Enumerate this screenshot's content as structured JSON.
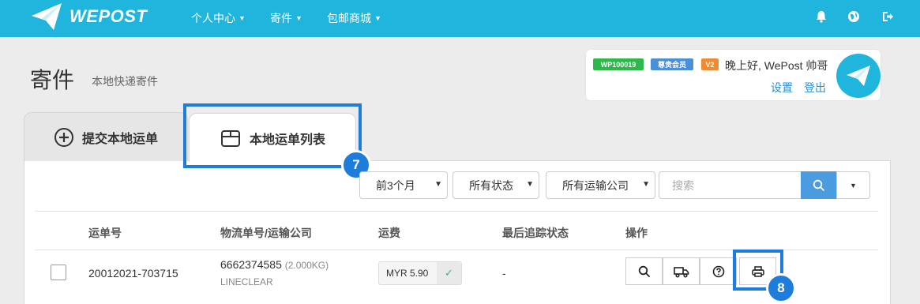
{
  "nav": {
    "logo_text": "WEPOST",
    "items": [
      {
        "label": "个人中心"
      },
      {
        "label": "寄件"
      },
      {
        "label": "包邮商城"
      }
    ]
  },
  "page": {
    "title": "寄件",
    "subtitle": "本地快递寄件"
  },
  "user": {
    "id_badge": "WP100019",
    "member_badge": "尊贵会员",
    "level_badge": "V2",
    "greeting": "晚上好, WePost 帅哥",
    "settings_label": "设置",
    "logout_label": "登出"
  },
  "tabs": [
    {
      "label": "提交本地运单"
    },
    {
      "label": "本地运单列表"
    }
  ],
  "markers": [
    "7",
    "8"
  ],
  "filters": {
    "period": "前3个月",
    "status": "所有状态",
    "carrier": "所有运输公司",
    "search_placeholder": "搜索"
  },
  "table": {
    "headers": [
      "运单号",
      "物流单号/运输公司",
      "运费",
      "最后追踪状态",
      "操作"
    ],
    "rows": [
      {
        "waybill": "20012021-703715",
        "tracking": "6662374585",
        "weight": "(2.000KG)",
        "carrier": "LINECLEAR",
        "fee": "MYR 5.90",
        "status": "-"
      }
    ]
  },
  "colors": {
    "nav_bg": "#1fb5dd",
    "highlight": "#1e7ddb",
    "badge_id": "#2fb84a",
    "badge_member": "#4a90d9",
    "badge_level": "#f28b30"
  }
}
